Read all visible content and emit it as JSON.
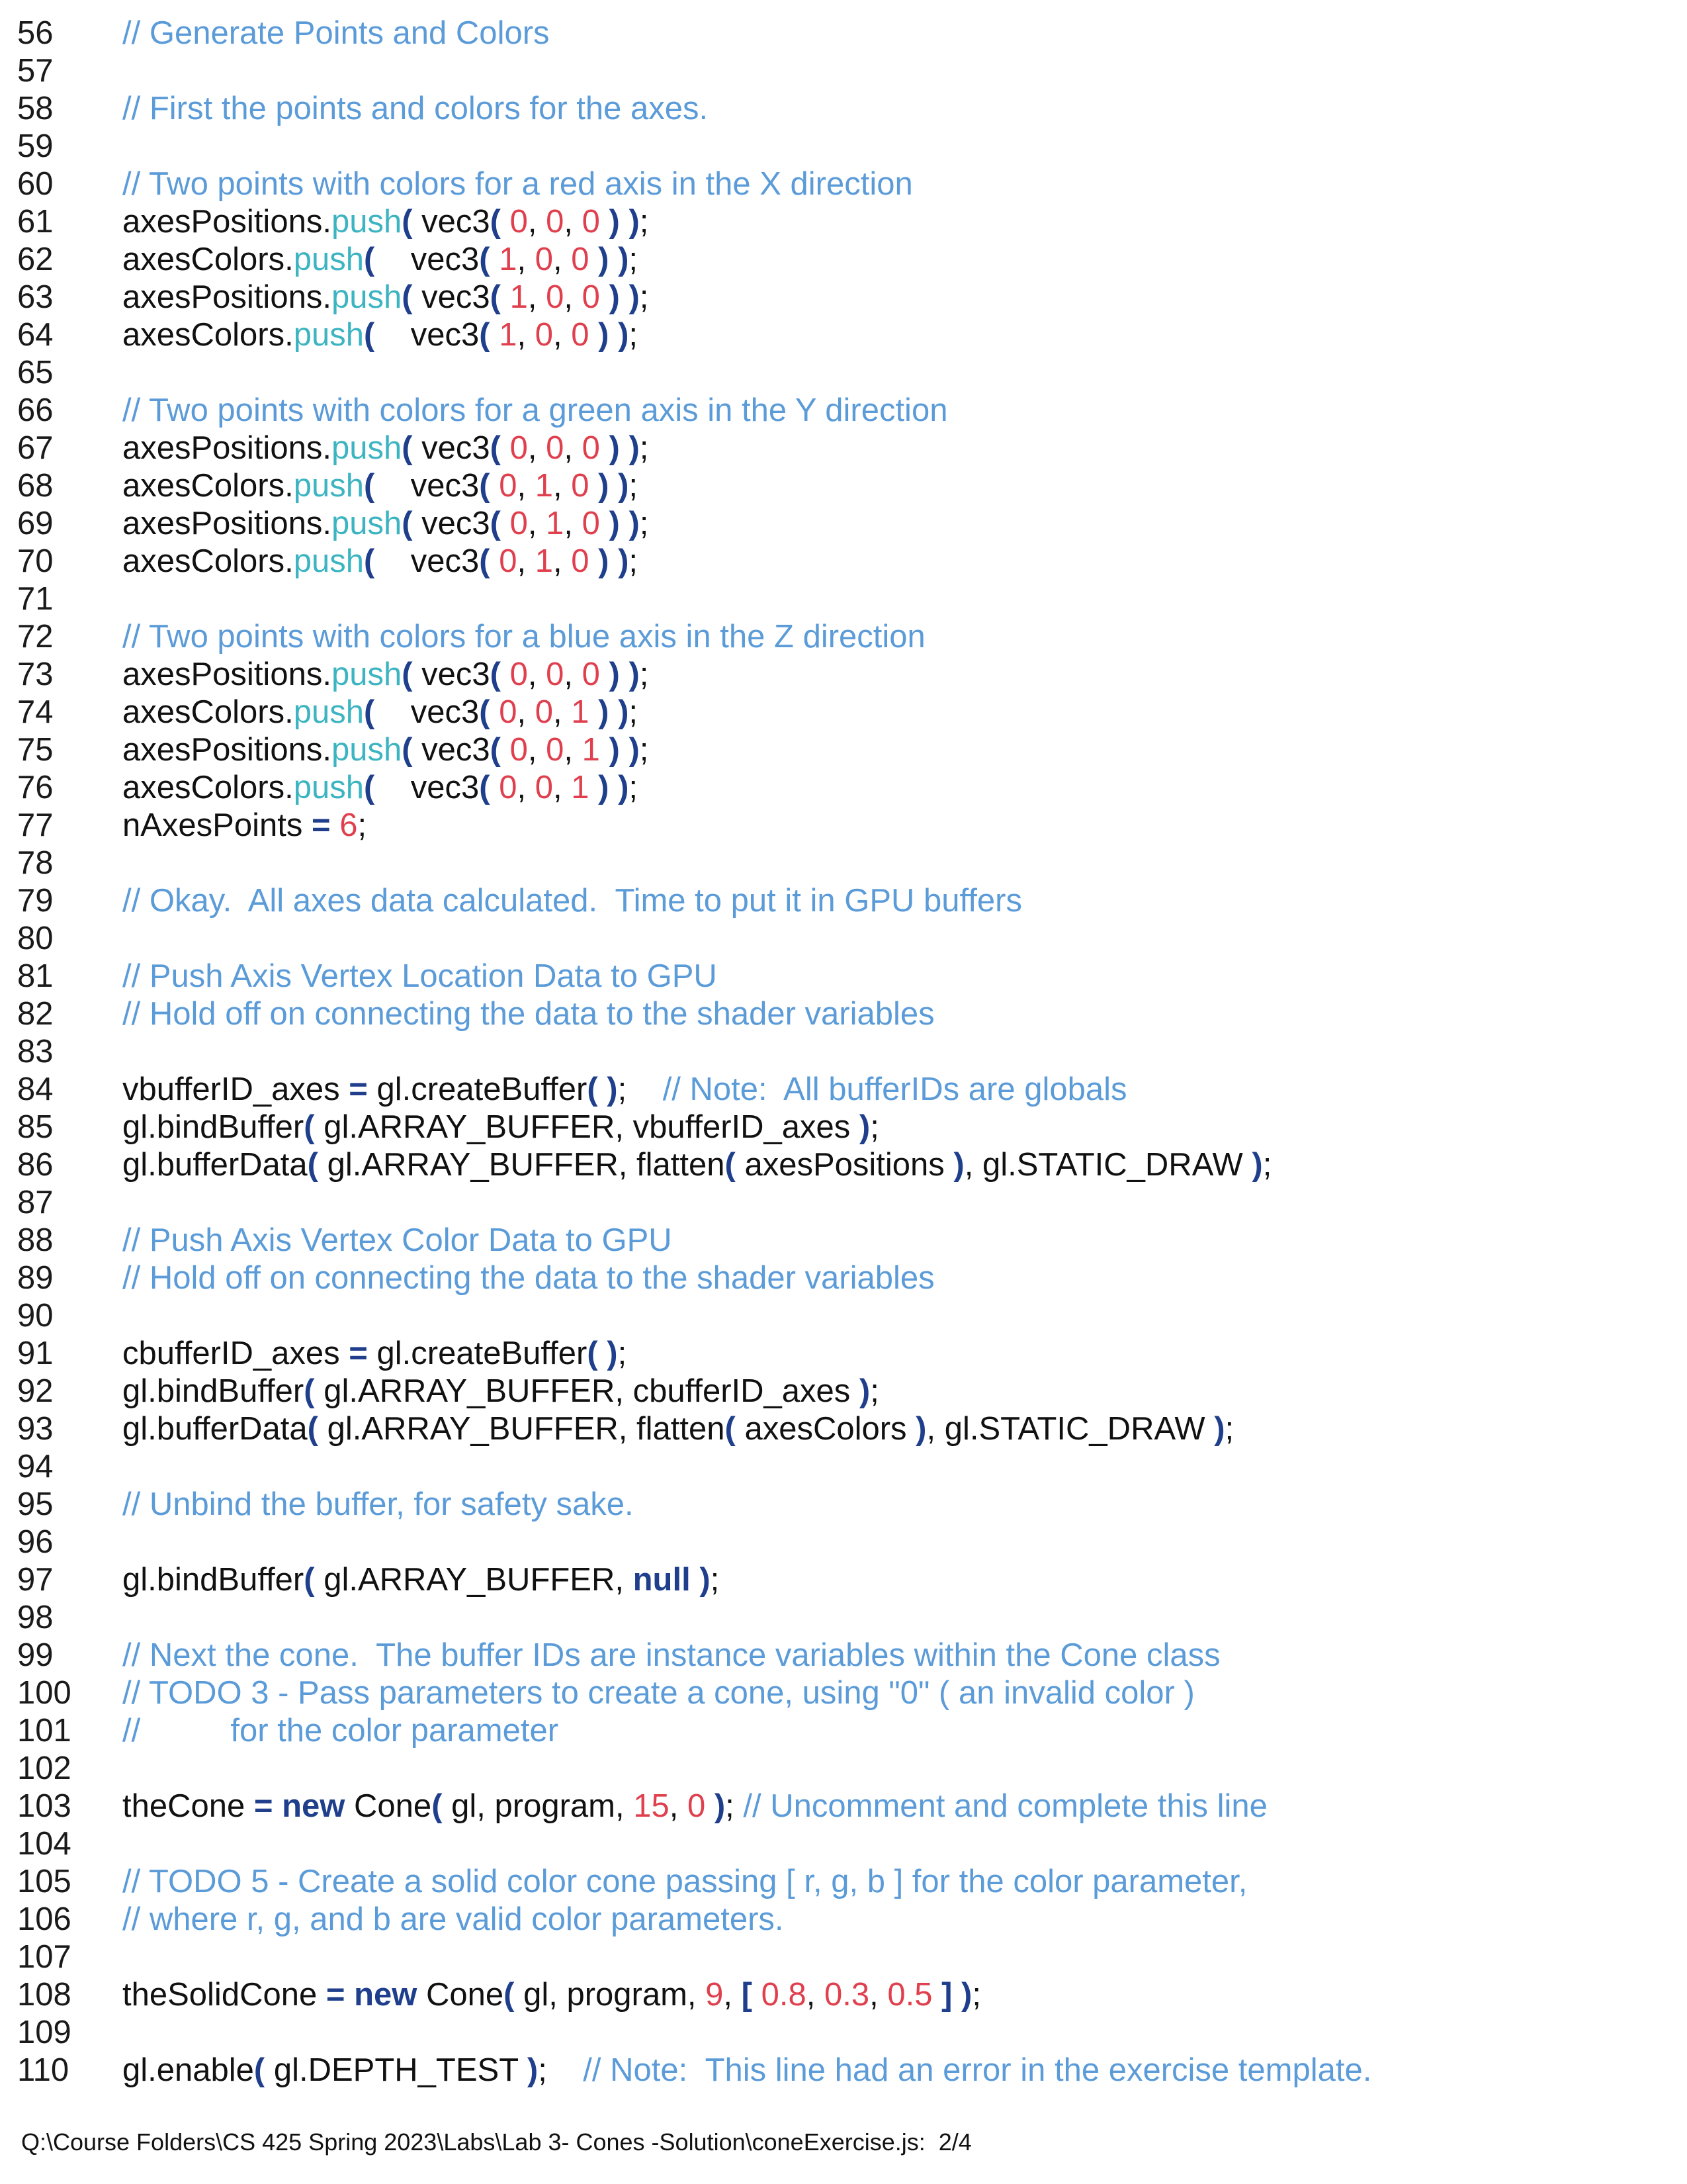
{
  "lines": [
    {
      "n": "56",
      "t": [
        [
          "cm",
          "// Generate Points and Colors"
        ]
      ]
    },
    {
      "n": "57",
      "t": []
    },
    {
      "n": "58",
      "t": [
        [
          "cm",
          "// First the points and colors for the axes."
        ]
      ]
    },
    {
      "n": "59",
      "t": []
    },
    {
      "n": "60",
      "t": [
        [
          "cm",
          "// Two points with colors for a red axis in the X direction"
        ]
      ]
    },
    {
      "n": "61",
      "t": [
        [
          "",
          "axesPositions."
        ],
        [
          "fn",
          "push"
        ],
        [
          "pn",
          "("
        ],
        [
          "",
          " vec3"
        ],
        [
          "pn",
          "("
        ],
        [
          "",
          " "
        ],
        [
          "nm",
          "0"
        ],
        [
          "",
          ", "
        ],
        [
          "nm",
          "0"
        ],
        [
          "",
          ", "
        ],
        [
          "nm",
          "0"
        ],
        [
          "",
          " "
        ],
        [
          "pn",
          ")"
        ],
        [
          "",
          " "
        ],
        [
          "pn",
          ")"
        ],
        [
          "",
          ";"
        ]
      ]
    },
    {
      "n": "62",
      "t": [
        [
          "",
          "axesColors."
        ],
        [
          "fn",
          "push"
        ],
        [
          "pn",
          "("
        ],
        [
          "",
          "    vec3"
        ],
        [
          "pn",
          "("
        ],
        [
          "",
          " "
        ],
        [
          "nm",
          "1"
        ],
        [
          "",
          ", "
        ],
        [
          "nm",
          "0"
        ],
        [
          "",
          ", "
        ],
        [
          "nm",
          "0"
        ],
        [
          "",
          " "
        ],
        [
          "pn",
          ")"
        ],
        [
          "",
          " "
        ],
        [
          "pn",
          ")"
        ],
        [
          "",
          ";"
        ]
      ]
    },
    {
      "n": "63",
      "t": [
        [
          "",
          "axesPositions."
        ],
        [
          "fn",
          "push"
        ],
        [
          "pn",
          "("
        ],
        [
          "",
          " vec3"
        ],
        [
          "pn",
          "("
        ],
        [
          "",
          " "
        ],
        [
          "nm",
          "1"
        ],
        [
          "",
          ", "
        ],
        [
          "nm",
          "0"
        ],
        [
          "",
          ", "
        ],
        [
          "nm",
          "0"
        ],
        [
          "",
          " "
        ],
        [
          "pn",
          ")"
        ],
        [
          "",
          " "
        ],
        [
          "pn",
          ")"
        ],
        [
          "",
          ";"
        ]
      ]
    },
    {
      "n": "64",
      "t": [
        [
          "",
          "axesColors."
        ],
        [
          "fn",
          "push"
        ],
        [
          "pn",
          "("
        ],
        [
          "",
          "    vec3"
        ],
        [
          "pn",
          "("
        ],
        [
          "",
          " "
        ],
        [
          "nm",
          "1"
        ],
        [
          "",
          ", "
        ],
        [
          "nm",
          "0"
        ],
        [
          "",
          ", "
        ],
        [
          "nm",
          "0"
        ],
        [
          "",
          " "
        ],
        [
          "pn",
          ")"
        ],
        [
          "",
          " "
        ],
        [
          "pn",
          ")"
        ],
        [
          "",
          ";"
        ]
      ]
    },
    {
      "n": "65",
      "t": []
    },
    {
      "n": "66",
      "t": [
        [
          "cm",
          "// Two points with colors for a green axis in the Y direction"
        ]
      ]
    },
    {
      "n": "67",
      "t": [
        [
          "",
          "axesPositions."
        ],
        [
          "fn",
          "push"
        ],
        [
          "pn",
          "("
        ],
        [
          "",
          " vec3"
        ],
        [
          "pn",
          "("
        ],
        [
          "",
          " "
        ],
        [
          "nm",
          "0"
        ],
        [
          "",
          ", "
        ],
        [
          "nm",
          "0"
        ],
        [
          "",
          ", "
        ],
        [
          "nm",
          "0"
        ],
        [
          "",
          " "
        ],
        [
          "pn",
          ")"
        ],
        [
          "",
          " "
        ],
        [
          "pn",
          ")"
        ],
        [
          "",
          ";"
        ]
      ]
    },
    {
      "n": "68",
      "t": [
        [
          "",
          "axesColors."
        ],
        [
          "fn",
          "push"
        ],
        [
          "pn",
          "("
        ],
        [
          "",
          "    vec3"
        ],
        [
          "pn",
          "("
        ],
        [
          "",
          " "
        ],
        [
          "nm",
          "0"
        ],
        [
          "",
          ", "
        ],
        [
          "nm",
          "1"
        ],
        [
          "",
          ", "
        ],
        [
          "nm",
          "0"
        ],
        [
          "",
          " "
        ],
        [
          "pn",
          ")"
        ],
        [
          "",
          " "
        ],
        [
          "pn",
          ")"
        ],
        [
          "",
          ";"
        ]
      ]
    },
    {
      "n": "69",
      "t": [
        [
          "",
          "axesPositions."
        ],
        [
          "fn",
          "push"
        ],
        [
          "pn",
          "("
        ],
        [
          "",
          " vec3"
        ],
        [
          "pn",
          "("
        ],
        [
          "",
          " "
        ],
        [
          "nm",
          "0"
        ],
        [
          "",
          ", "
        ],
        [
          "nm",
          "1"
        ],
        [
          "",
          ", "
        ],
        [
          "nm",
          "0"
        ],
        [
          "",
          " "
        ],
        [
          "pn",
          ")"
        ],
        [
          "",
          " "
        ],
        [
          "pn",
          ")"
        ],
        [
          "",
          ";"
        ]
      ]
    },
    {
      "n": "70",
      "t": [
        [
          "",
          "axesColors."
        ],
        [
          "fn",
          "push"
        ],
        [
          "pn",
          "("
        ],
        [
          "",
          "    vec3"
        ],
        [
          "pn",
          "("
        ],
        [
          "",
          " "
        ],
        [
          "nm",
          "0"
        ],
        [
          "",
          ", "
        ],
        [
          "nm",
          "1"
        ],
        [
          "",
          ", "
        ],
        [
          "nm",
          "0"
        ],
        [
          "",
          " "
        ],
        [
          "pn",
          ")"
        ],
        [
          "",
          " "
        ],
        [
          "pn",
          ")"
        ],
        [
          "",
          ";"
        ]
      ]
    },
    {
      "n": "71",
      "t": []
    },
    {
      "n": "72",
      "t": [
        [
          "cm",
          "// Two points with colors for a blue axis in the Z direction"
        ]
      ]
    },
    {
      "n": "73",
      "t": [
        [
          "",
          "axesPositions."
        ],
        [
          "fn",
          "push"
        ],
        [
          "pn",
          "("
        ],
        [
          "",
          " vec3"
        ],
        [
          "pn",
          "("
        ],
        [
          "",
          " "
        ],
        [
          "nm",
          "0"
        ],
        [
          "",
          ", "
        ],
        [
          "nm",
          "0"
        ],
        [
          "",
          ", "
        ],
        [
          "nm",
          "0"
        ],
        [
          "",
          " "
        ],
        [
          "pn",
          ")"
        ],
        [
          "",
          " "
        ],
        [
          "pn",
          ")"
        ],
        [
          "",
          ";"
        ]
      ]
    },
    {
      "n": "74",
      "t": [
        [
          "",
          "axesColors."
        ],
        [
          "fn",
          "push"
        ],
        [
          "pn",
          "("
        ],
        [
          "",
          "    vec3"
        ],
        [
          "pn",
          "("
        ],
        [
          "",
          " "
        ],
        [
          "nm",
          "0"
        ],
        [
          "",
          ", "
        ],
        [
          "nm",
          "0"
        ],
        [
          "",
          ", "
        ],
        [
          "nm",
          "1"
        ],
        [
          "",
          " "
        ],
        [
          "pn",
          ")"
        ],
        [
          "",
          " "
        ],
        [
          "pn",
          ")"
        ],
        [
          "",
          ";"
        ]
      ]
    },
    {
      "n": "75",
      "t": [
        [
          "",
          "axesPositions."
        ],
        [
          "fn",
          "push"
        ],
        [
          "pn",
          "("
        ],
        [
          "",
          " vec3"
        ],
        [
          "pn",
          "("
        ],
        [
          "",
          " "
        ],
        [
          "nm",
          "0"
        ],
        [
          "",
          ", "
        ],
        [
          "nm",
          "0"
        ],
        [
          "",
          ", "
        ],
        [
          "nm",
          "1"
        ],
        [
          "",
          " "
        ],
        [
          "pn",
          ")"
        ],
        [
          "",
          " "
        ],
        [
          "pn",
          ")"
        ],
        [
          "",
          ";"
        ]
      ]
    },
    {
      "n": "76",
      "t": [
        [
          "",
          "axesColors."
        ],
        [
          "fn",
          "push"
        ],
        [
          "pn",
          "("
        ],
        [
          "",
          "    vec3"
        ],
        [
          "pn",
          "("
        ],
        [
          "",
          " "
        ],
        [
          "nm",
          "0"
        ],
        [
          "",
          ", "
        ],
        [
          "nm",
          "0"
        ],
        [
          "",
          ", "
        ],
        [
          "nm",
          "1"
        ],
        [
          "",
          " "
        ],
        [
          "pn",
          ")"
        ],
        [
          "",
          " "
        ],
        [
          "pn",
          ")"
        ],
        [
          "",
          ";"
        ]
      ]
    },
    {
      "n": "77",
      "t": [
        [
          "",
          "nAxesPoints "
        ],
        [
          "pn",
          "="
        ],
        [
          "",
          " "
        ],
        [
          "nm",
          "6"
        ],
        [
          "",
          ";"
        ]
      ]
    },
    {
      "n": "78",
      "t": []
    },
    {
      "n": "79",
      "t": [
        [
          "cm",
          "// Okay.  All axes data calculated.  Time to put it in GPU buffers"
        ]
      ]
    },
    {
      "n": "80",
      "t": []
    },
    {
      "n": "81",
      "t": [
        [
          "cm",
          "// Push Axis Vertex Location Data to GPU"
        ]
      ]
    },
    {
      "n": "82",
      "t": [
        [
          "cm",
          "// Hold off on connecting the data to the shader variables"
        ]
      ]
    },
    {
      "n": "83",
      "t": []
    },
    {
      "n": "84",
      "t": [
        [
          "",
          "vbufferID_axes "
        ],
        [
          "pn",
          "="
        ],
        [
          "",
          " gl.createBuffer"
        ],
        [
          "pn",
          "("
        ],
        [
          "",
          " "
        ],
        [
          "pn",
          ")"
        ],
        [
          "",
          ";    "
        ],
        [
          "cm",
          "// Note:  All bufferIDs are globals"
        ]
      ]
    },
    {
      "n": "85",
      "t": [
        [
          "",
          "gl.bindBuffer"
        ],
        [
          "pn",
          "("
        ],
        [
          "",
          " gl.ARRAY_BUFFER, vbufferID_axes "
        ],
        [
          "pn",
          ")"
        ],
        [
          "",
          ";"
        ]
      ]
    },
    {
      "n": "86",
      "t": [
        [
          "",
          "gl.bufferData"
        ],
        [
          "pn",
          "("
        ],
        [
          "",
          " gl.ARRAY_BUFFER, flatten"
        ],
        [
          "pn",
          "("
        ],
        [
          "",
          " axesPositions "
        ],
        [
          "pn",
          ")"
        ],
        [
          "",
          ", gl.STATIC_DRAW "
        ],
        [
          "pn",
          ")"
        ],
        [
          "",
          ";"
        ]
      ]
    },
    {
      "n": "87",
      "t": []
    },
    {
      "n": "88",
      "t": [
        [
          "cm",
          "// Push Axis Vertex Color Data to GPU"
        ]
      ]
    },
    {
      "n": "89",
      "t": [
        [
          "cm",
          "// Hold off on connecting the data to the shader variables"
        ]
      ]
    },
    {
      "n": "90",
      "t": []
    },
    {
      "n": "91",
      "t": [
        [
          "",
          "cbufferID_axes "
        ],
        [
          "pn",
          "="
        ],
        [
          "",
          " gl.createBuffer"
        ],
        [
          "pn",
          "("
        ],
        [
          "",
          " "
        ],
        [
          "pn",
          ")"
        ],
        [
          "",
          ";"
        ]
      ]
    },
    {
      "n": "92",
      "t": [
        [
          "",
          "gl.bindBuffer"
        ],
        [
          "pn",
          "("
        ],
        [
          "",
          " gl.ARRAY_BUFFER, cbufferID_axes "
        ],
        [
          "pn",
          ")"
        ],
        [
          "",
          ";"
        ]
      ]
    },
    {
      "n": "93",
      "t": [
        [
          "",
          "gl.bufferData"
        ],
        [
          "pn",
          "("
        ],
        [
          "",
          " gl.ARRAY_BUFFER, flatten"
        ],
        [
          "pn",
          "("
        ],
        [
          "",
          " axesColors "
        ],
        [
          "pn",
          ")"
        ],
        [
          "",
          ", gl.STATIC_DRAW "
        ],
        [
          "pn",
          ")"
        ],
        [
          "",
          ";"
        ]
      ]
    },
    {
      "n": "94",
      "t": []
    },
    {
      "n": "95",
      "t": [
        [
          "cm",
          "// Unbind the buffer, for safety sake."
        ]
      ]
    },
    {
      "n": "96",
      "t": []
    },
    {
      "n": "97",
      "t": [
        [
          "",
          "gl.bindBuffer"
        ],
        [
          "pn",
          "("
        ],
        [
          "",
          " gl.ARRAY_BUFFER, "
        ],
        [
          "kw",
          "null"
        ],
        [
          "",
          " "
        ],
        [
          "pn",
          ")"
        ],
        [
          "",
          ";"
        ]
      ]
    },
    {
      "n": "98",
      "t": []
    },
    {
      "n": "99",
      "t": [
        [
          "cm",
          "// Next the cone.  The buffer IDs are instance variables within the Cone class"
        ]
      ]
    },
    {
      "n": "100",
      "t": [
        [
          "cm",
          "// TODO 3 - Pass parameters to create a cone, using \"0\" ( an invalid color )"
        ]
      ]
    },
    {
      "n": "101",
      "t": [
        [
          "cm",
          "//          for the color parameter"
        ]
      ]
    },
    {
      "n": "102",
      "t": []
    },
    {
      "n": "103",
      "t": [
        [
          "",
          "theCone "
        ],
        [
          "pn",
          "="
        ],
        [
          "",
          " "
        ],
        [
          "kw",
          "new"
        ],
        [
          "",
          " Cone"
        ],
        [
          "pn",
          "("
        ],
        [
          "",
          " gl, program, "
        ],
        [
          "nm",
          "15"
        ],
        [
          "",
          ", "
        ],
        [
          "nm",
          "0"
        ],
        [
          "",
          " "
        ],
        [
          "pn",
          ")"
        ],
        [
          "",
          "; "
        ],
        [
          "cm",
          "// Uncomment and complete this line"
        ]
      ]
    },
    {
      "n": "104",
      "t": []
    },
    {
      "n": "105",
      "t": [
        [
          "cm",
          "// TODO 5 - Create a solid color cone passing [ r, g, b ] for the color parameter,"
        ]
      ]
    },
    {
      "n": "106",
      "t": [
        [
          "cm",
          "// where r, g, and b are valid color parameters."
        ]
      ]
    },
    {
      "n": "107",
      "t": []
    },
    {
      "n": "108",
      "t": [
        [
          "",
          "theSolidCone "
        ],
        [
          "pn",
          "="
        ],
        [
          "",
          " "
        ],
        [
          "kw",
          "new"
        ],
        [
          "",
          " Cone"
        ],
        [
          "pn",
          "("
        ],
        [
          "",
          " gl, program, "
        ],
        [
          "nm",
          "9"
        ],
        [
          "",
          ", "
        ],
        [
          "pn",
          "["
        ],
        [
          "",
          " "
        ],
        [
          "nm",
          "0.8"
        ],
        [
          "",
          ", "
        ],
        [
          "nm",
          "0.3"
        ],
        [
          "",
          ", "
        ],
        [
          "nm",
          "0.5"
        ],
        [
          "",
          " "
        ],
        [
          "pn",
          "]"
        ],
        [
          "",
          " "
        ],
        [
          "pn",
          ")"
        ],
        [
          "",
          ";"
        ]
      ]
    },
    {
      "n": "109",
      "t": []
    },
    {
      "n": "110",
      "t": [
        [
          "",
          "gl.enable"
        ],
        [
          "pn",
          "("
        ],
        [
          "",
          " gl.DEPTH_TEST "
        ],
        [
          "pn",
          ")"
        ],
        [
          "",
          ";    "
        ],
        [
          "cm",
          "// Note:  This line had an error in the exercise template."
        ]
      ]
    }
  ],
  "footer": "Q:\\Course Folders\\CS 425 Spring 2023\\Labs\\Lab 3- Cones -Solution\\coneExercise.js:  2/4",
  "colors": {
    "comment": "#5b9bd8",
    "function": "#3cb4c1",
    "number": "#e0404e",
    "keyword": "#1f3f8c",
    "text": "#111111"
  }
}
